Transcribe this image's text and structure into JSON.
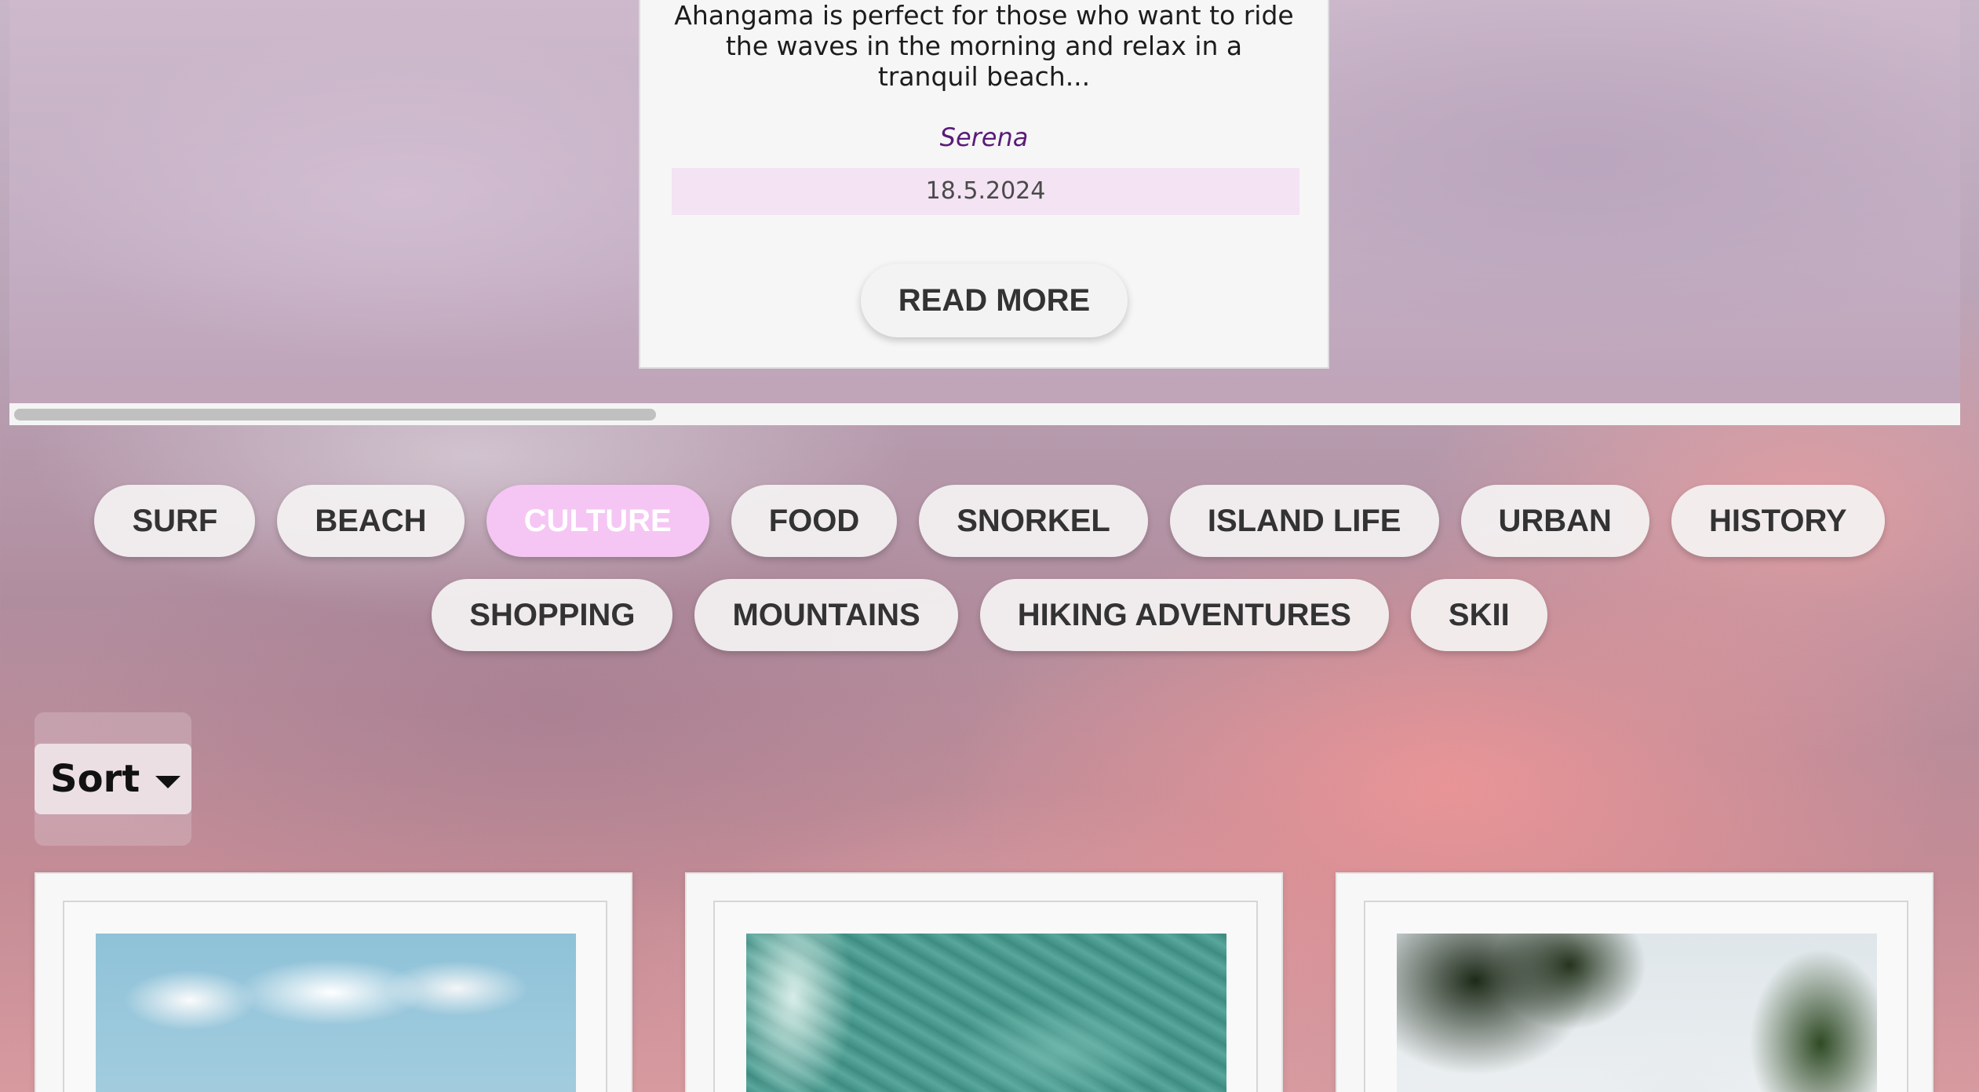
{
  "featured_post": {
    "description": "Ahangama is perfect for those who want to ride the waves in the morning and relax in a tranquil beach...",
    "author": "Serena",
    "date": "18.5.2024",
    "read_more_label": "READ MORE"
  },
  "categories": {
    "active": "CULTURE",
    "items": [
      "SURF",
      "BEACH",
      "CULTURE",
      "FOOD",
      "SNORKEL",
      "ISLAND LIFE",
      "URBAN",
      "HISTORY",
      "SHOPPING",
      "MOUNTAINS",
      "HIKING ADVENTURES",
      "SKII"
    ]
  },
  "sort": {
    "label": "Sort",
    "icon": "caret-down-icon"
  },
  "colors": {
    "active_tag": "#f5c6f3",
    "author": "#5a1b78",
    "date_band": "#f3e3f3"
  }
}
